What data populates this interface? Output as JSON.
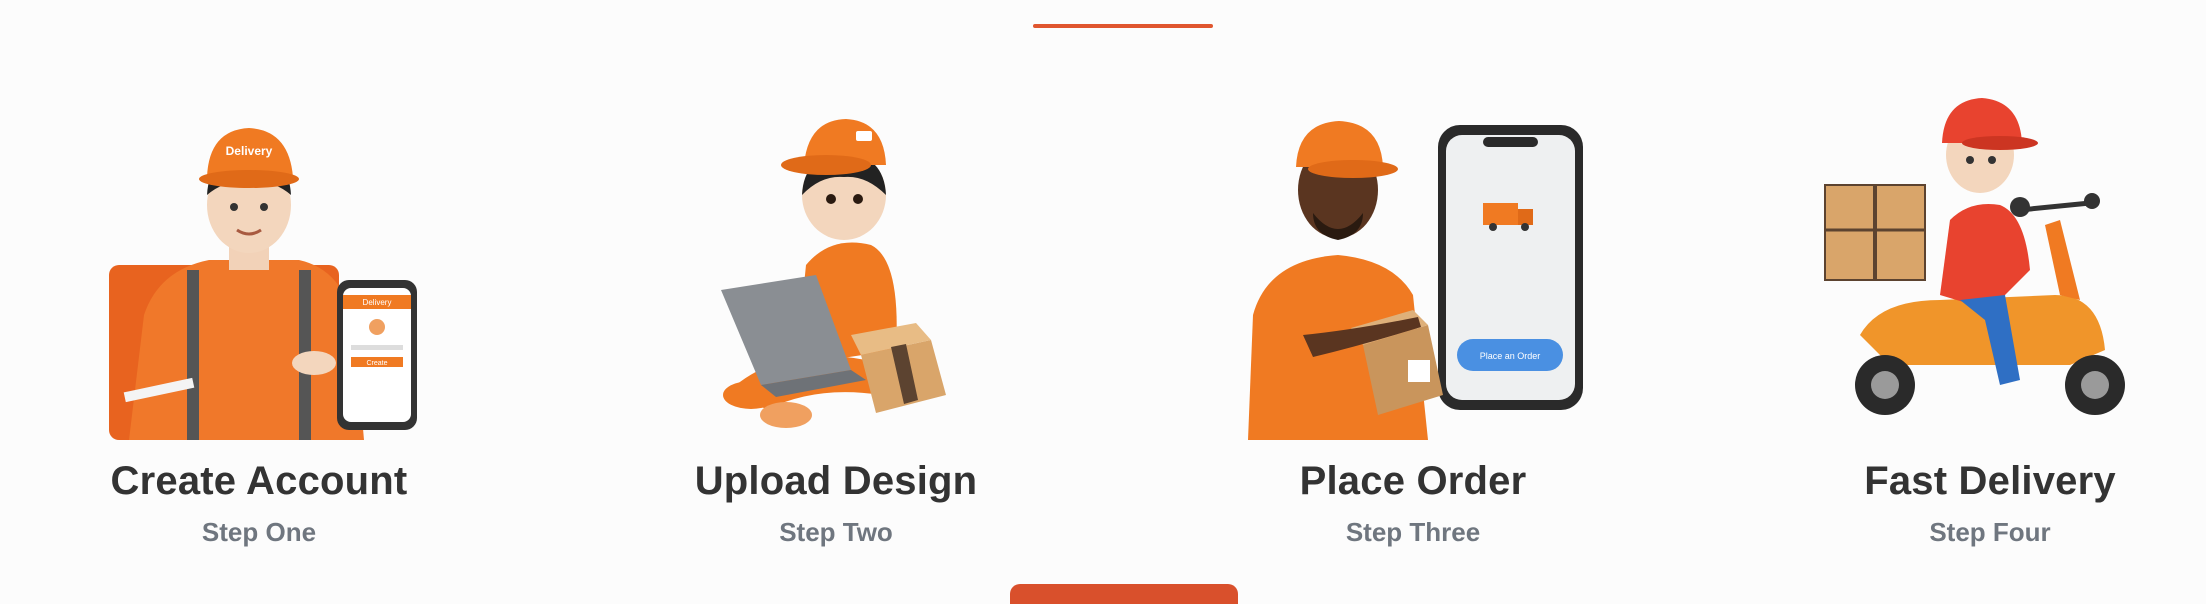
{
  "colors": {
    "accent": "#e0562f",
    "orange": "#f07a22",
    "title": "#333333",
    "subtitle": "#6f767f"
  },
  "steps": [
    {
      "title": "Create Account",
      "subtitle": "Step One",
      "illustration": "courier-with-phone-signup"
    },
    {
      "title": "Upload Design",
      "subtitle": "Step Two",
      "illustration": "courier-with-laptop-and-box"
    },
    {
      "title": "Place Order",
      "subtitle": "Step Three",
      "illustration": "courier-with-box-and-phone-order"
    },
    {
      "title": "Fast Delivery",
      "subtitle": "Step Four",
      "illustration": "courier-on-scooter"
    }
  ],
  "illustration_text": {
    "cap_logo": "Delivery",
    "phone_header": "Delivery",
    "phone_button": "Create",
    "order_button": "Place an Order"
  }
}
